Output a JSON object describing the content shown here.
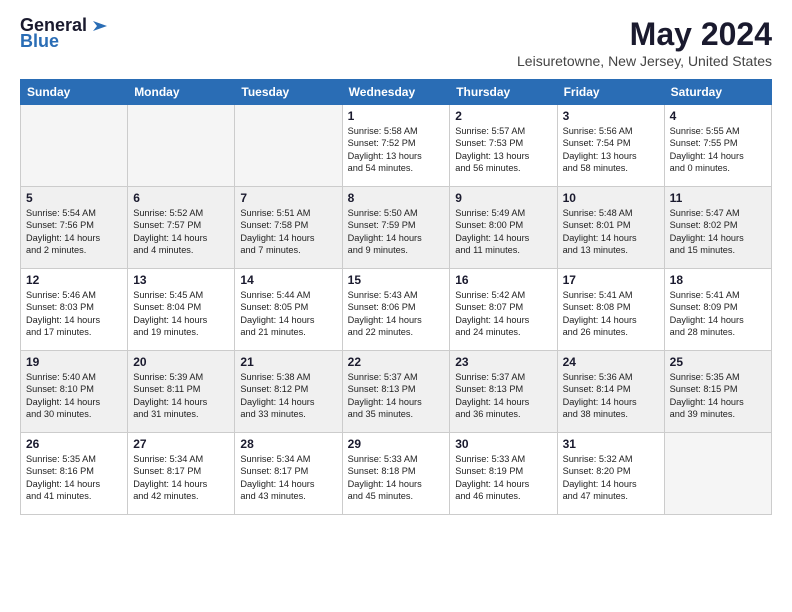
{
  "logo": {
    "general": "General",
    "blue": "Blue"
  },
  "title": "May 2024",
  "location": "Leisuretowne, New Jersey, United States",
  "weekdays": [
    "Sunday",
    "Monday",
    "Tuesday",
    "Wednesday",
    "Thursday",
    "Friday",
    "Saturday"
  ],
  "weeks": [
    [
      {
        "num": "",
        "info": ""
      },
      {
        "num": "",
        "info": ""
      },
      {
        "num": "",
        "info": ""
      },
      {
        "num": "1",
        "info": "Sunrise: 5:58 AM\nSunset: 7:52 PM\nDaylight: 13 hours\nand 54 minutes."
      },
      {
        "num": "2",
        "info": "Sunrise: 5:57 AM\nSunset: 7:53 PM\nDaylight: 13 hours\nand 56 minutes."
      },
      {
        "num": "3",
        "info": "Sunrise: 5:56 AM\nSunset: 7:54 PM\nDaylight: 13 hours\nand 58 minutes."
      },
      {
        "num": "4",
        "info": "Sunrise: 5:55 AM\nSunset: 7:55 PM\nDaylight: 14 hours\nand 0 minutes."
      }
    ],
    [
      {
        "num": "5",
        "info": "Sunrise: 5:54 AM\nSunset: 7:56 PM\nDaylight: 14 hours\nand 2 minutes."
      },
      {
        "num": "6",
        "info": "Sunrise: 5:52 AM\nSunset: 7:57 PM\nDaylight: 14 hours\nand 4 minutes."
      },
      {
        "num": "7",
        "info": "Sunrise: 5:51 AM\nSunset: 7:58 PM\nDaylight: 14 hours\nand 7 minutes."
      },
      {
        "num": "8",
        "info": "Sunrise: 5:50 AM\nSunset: 7:59 PM\nDaylight: 14 hours\nand 9 minutes."
      },
      {
        "num": "9",
        "info": "Sunrise: 5:49 AM\nSunset: 8:00 PM\nDaylight: 14 hours\nand 11 minutes."
      },
      {
        "num": "10",
        "info": "Sunrise: 5:48 AM\nSunset: 8:01 PM\nDaylight: 14 hours\nand 13 minutes."
      },
      {
        "num": "11",
        "info": "Sunrise: 5:47 AM\nSunset: 8:02 PM\nDaylight: 14 hours\nand 15 minutes."
      }
    ],
    [
      {
        "num": "12",
        "info": "Sunrise: 5:46 AM\nSunset: 8:03 PM\nDaylight: 14 hours\nand 17 minutes."
      },
      {
        "num": "13",
        "info": "Sunrise: 5:45 AM\nSunset: 8:04 PM\nDaylight: 14 hours\nand 19 minutes."
      },
      {
        "num": "14",
        "info": "Sunrise: 5:44 AM\nSunset: 8:05 PM\nDaylight: 14 hours\nand 21 minutes."
      },
      {
        "num": "15",
        "info": "Sunrise: 5:43 AM\nSunset: 8:06 PM\nDaylight: 14 hours\nand 22 minutes."
      },
      {
        "num": "16",
        "info": "Sunrise: 5:42 AM\nSunset: 8:07 PM\nDaylight: 14 hours\nand 24 minutes."
      },
      {
        "num": "17",
        "info": "Sunrise: 5:41 AM\nSunset: 8:08 PM\nDaylight: 14 hours\nand 26 minutes."
      },
      {
        "num": "18",
        "info": "Sunrise: 5:41 AM\nSunset: 8:09 PM\nDaylight: 14 hours\nand 28 minutes."
      }
    ],
    [
      {
        "num": "19",
        "info": "Sunrise: 5:40 AM\nSunset: 8:10 PM\nDaylight: 14 hours\nand 30 minutes."
      },
      {
        "num": "20",
        "info": "Sunrise: 5:39 AM\nSunset: 8:11 PM\nDaylight: 14 hours\nand 31 minutes."
      },
      {
        "num": "21",
        "info": "Sunrise: 5:38 AM\nSunset: 8:12 PM\nDaylight: 14 hours\nand 33 minutes."
      },
      {
        "num": "22",
        "info": "Sunrise: 5:37 AM\nSunset: 8:13 PM\nDaylight: 14 hours\nand 35 minutes."
      },
      {
        "num": "23",
        "info": "Sunrise: 5:37 AM\nSunset: 8:13 PM\nDaylight: 14 hours\nand 36 minutes."
      },
      {
        "num": "24",
        "info": "Sunrise: 5:36 AM\nSunset: 8:14 PM\nDaylight: 14 hours\nand 38 minutes."
      },
      {
        "num": "25",
        "info": "Sunrise: 5:35 AM\nSunset: 8:15 PM\nDaylight: 14 hours\nand 39 minutes."
      }
    ],
    [
      {
        "num": "26",
        "info": "Sunrise: 5:35 AM\nSunset: 8:16 PM\nDaylight: 14 hours\nand 41 minutes."
      },
      {
        "num": "27",
        "info": "Sunrise: 5:34 AM\nSunset: 8:17 PM\nDaylight: 14 hours\nand 42 minutes."
      },
      {
        "num": "28",
        "info": "Sunrise: 5:34 AM\nSunset: 8:17 PM\nDaylight: 14 hours\nand 43 minutes."
      },
      {
        "num": "29",
        "info": "Sunrise: 5:33 AM\nSunset: 8:18 PM\nDaylight: 14 hours\nand 45 minutes."
      },
      {
        "num": "30",
        "info": "Sunrise: 5:33 AM\nSunset: 8:19 PM\nDaylight: 14 hours\nand 46 minutes."
      },
      {
        "num": "31",
        "info": "Sunrise: 5:32 AM\nSunset: 8:20 PM\nDaylight: 14 hours\nand 47 minutes."
      },
      {
        "num": "",
        "info": ""
      }
    ]
  ]
}
